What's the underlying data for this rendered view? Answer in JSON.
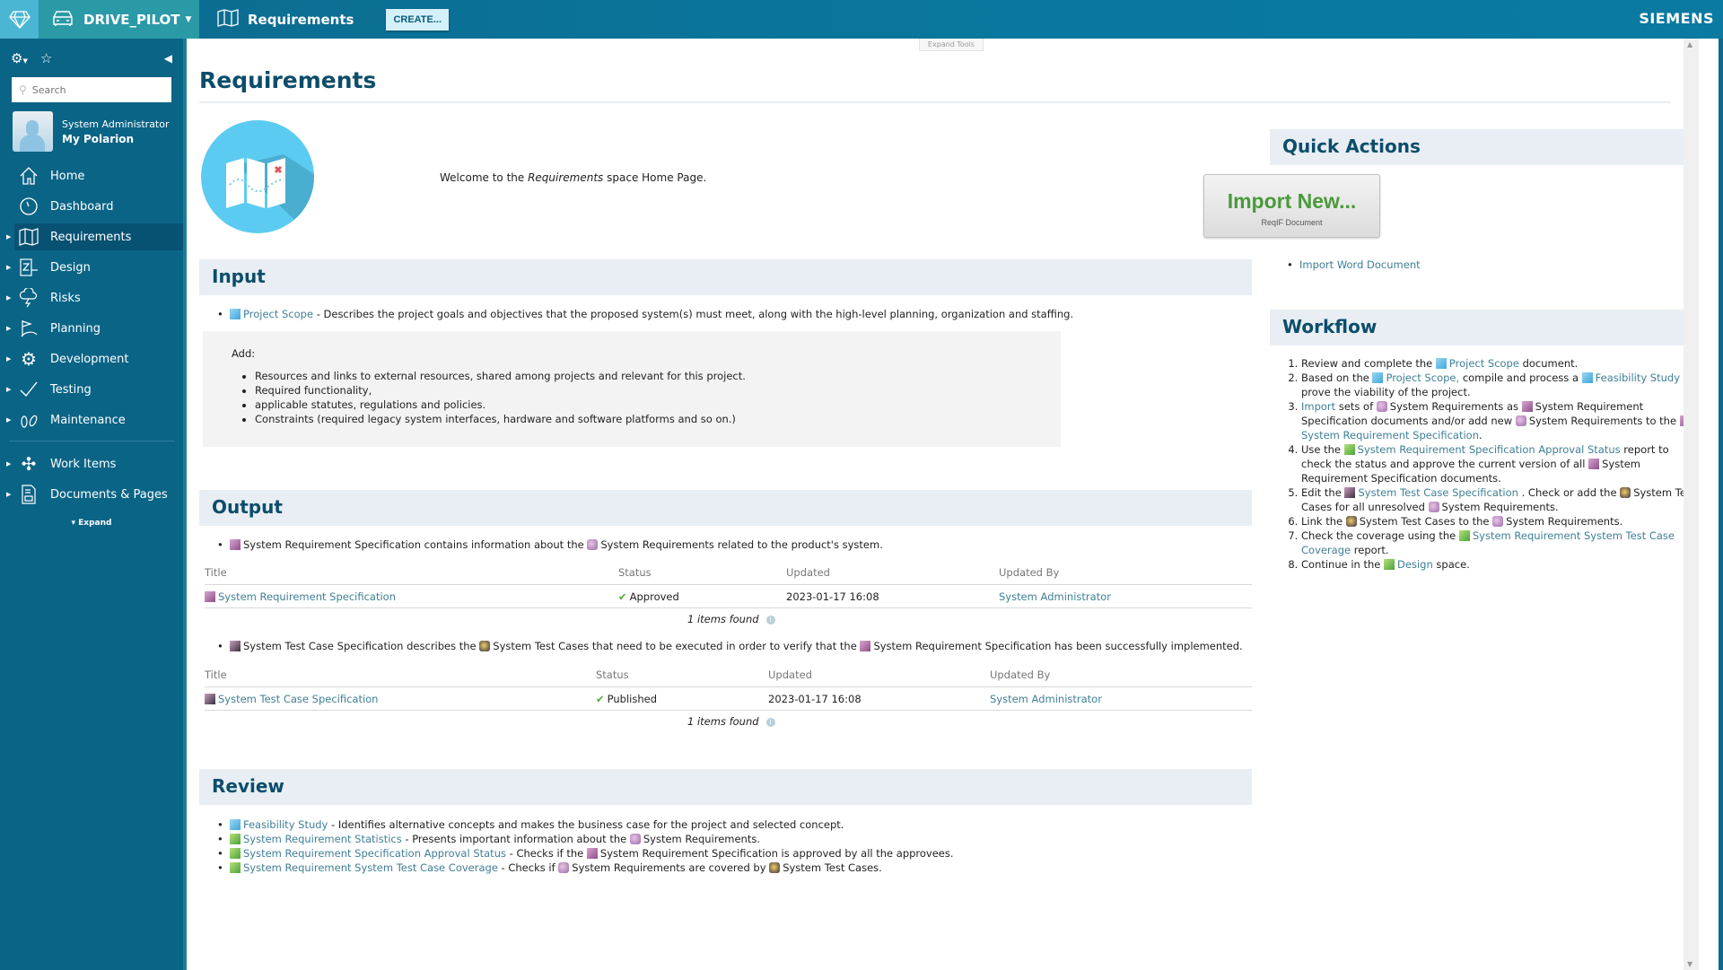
{
  "topbar": {
    "project": "DRIVE_PILOT",
    "space": "Requirements",
    "create_label": "CREATE...",
    "brand": "SIEMENS"
  },
  "sidebar": {
    "search_placeholder": "Search",
    "user_name": "System Administrator",
    "my_polarion": "My Polarion",
    "items": [
      {
        "label": "Home",
        "icon": "home-icon"
      },
      {
        "label": "Dashboard",
        "icon": "dashboard-icon"
      },
      {
        "label": "Requirements",
        "icon": "map-icon",
        "active": true
      },
      {
        "label": "Design",
        "icon": "design-icon"
      },
      {
        "label": "Risks",
        "icon": "storm-cloud-icon"
      },
      {
        "label": "Planning",
        "icon": "flag-icon"
      },
      {
        "label": "Development",
        "icon": "gears-icon"
      },
      {
        "label": "Testing",
        "icon": "checkmark-icon"
      },
      {
        "label": "Maintenance",
        "icon": "footprints-icon"
      }
    ],
    "items2": [
      {
        "label": "Work Items",
        "icon": "puzzle-icon"
      },
      {
        "label": "Documents & Pages",
        "icon": "document-icon"
      }
    ],
    "expand_label": "Expand"
  },
  "main": {
    "expand_tools": "Expand Tools",
    "title": "Requirements",
    "welcome_pre": "Welcome to the ",
    "welcome_em": "Requirements",
    "welcome_post": " space Home Page.",
    "input": {
      "heading": "Input",
      "link": "Project Scope",
      "desc": " - Describes the project goals and objectives that the proposed system(s) must meet, along with the high-level planning, organization and staffing.",
      "add_label": "Add:",
      "add_items": [
        "Resources and links to external resources, shared among projects and relevant for this project.",
        "Required functionality,",
        "applicable statutes, regulations and policies.",
        "Constraints (required legacy system interfaces, hardware and software platforms and so on.)"
      ]
    },
    "output": {
      "heading": "Output",
      "bullet1": {
        "a": "System Requirement Specification contains information about the ",
        "b": "System Requirements related to the product's system."
      },
      "table_headers": [
        "Title",
        "Status",
        "Updated",
        "Updated By"
      ],
      "table1": {
        "title": "System Requirement Specification",
        "status": "Approved",
        "updated": "2023-01-17 16:08",
        "updated_by": "System Administrator",
        "found": "1 items found"
      },
      "bullet2": {
        "a": "System Test Case Specification describes the ",
        "b": "System Test Cases that need to be executed in order to verify that the ",
        "c": "System Requirement Specification has been successfully implemented."
      },
      "table2": {
        "title": "System Test Case Specification",
        "status": "Published",
        "updated": "2023-01-17 16:08",
        "updated_by": "System Administrator",
        "found": "1 items found"
      }
    },
    "review": {
      "heading": "Review",
      "items": [
        {
          "link": "Feasibility Study",
          "desc": " - Identifies alternative concepts and makes the business case for the project and selected concept."
        },
        {
          "link": "System Requirement Statistics",
          "desc": " - Presents important information about the ",
          "desc2": "System Requirements."
        },
        {
          "link": "System Requirement Specification Approval Status",
          "desc": " - Checks if the ",
          "desc2": "System Requirement Specification is approved by all the approvees."
        },
        {
          "link": "System Requirement System Test Case Coverage",
          "desc": " - Checks if ",
          "desc2": "System Requirements are covered by ",
          "desc3": "System Test Cases."
        }
      ]
    }
  },
  "right": {
    "quick_actions": "Quick Actions",
    "import_big": "Import New...",
    "import_small": "ReqIF Document",
    "import_word": "Import Word Document",
    "workflow": "Workflow",
    "wf": {
      "s1a": "Review and complete the ",
      "s1l": "Project Scope",
      "s1b": " document.",
      "s2a": "Based on the ",
      "s2l1": "Project Scope,",
      "s2b": " compile and process a ",
      "s2l2": "Feasibility Study",
      "s2c": " to prove the viability of the project.",
      "s3l": "Import",
      "s3a": " sets of ",
      "s3b": "System Requirements as ",
      "s3c": "System Requirement Specification documents and/or add new ",
      "s3d": "System Requirements to the ",
      "s3l2": "System Requirement Specification",
      "s3e": ".",
      "s4a": "Use the ",
      "s4l": "System Requirement Specification Approval Status",
      "s4b": " report to check the status and approve the current version of all ",
      "s4c": "System Requirement Specification documents.",
      "s5a": "Edit the ",
      "s5l": "System Test Case Specification",
      "s5b": " . Check or add the ",
      "s5c": "System Test Cases for all unresolved ",
      "s5d": "System Requirements.",
      "s6a": "Link the ",
      "s6b": "System Test Cases to the ",
      "s6c": "System Requirements.",
      "s7a": "Check the coverage using the ",
      "s7l": "System Requirement System Test Case Coverage",
      "s7b": " report.",
      "s8a": "Continue in the ",
      "s8l": "Design",
      "s8b": " space."
    }
  }
}
